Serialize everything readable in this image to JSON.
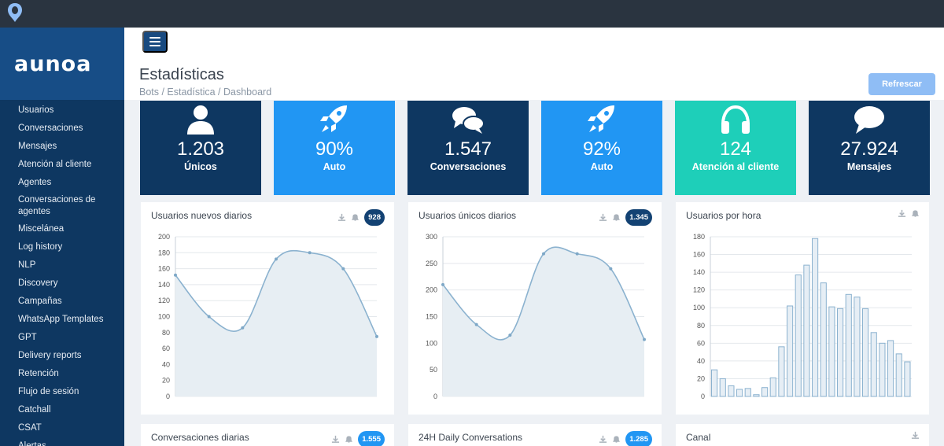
{
  "app": {
    "brand": "aunoa"
  },
  "sidebar": {
    "items": [
      {
        "label": "Usuarios"
      },
      {
        "label": "Conversaciones"
      },
      {
        "label": "Mensajes"
      },
      {
        "label": "Atención al cliente"
      },
      {
        "label": "Agentes"
      },
      {
        "label": "Conversaciones de agentes"
      },
      {
        "label": "Miscelánea"
      },
      {
        "label": "Log history"
      },
      {
        "label": "NLP"
      },
      {
        "label": "Discovery"
      },
      {
        "label": "Campañas"
      },
      {
        "label": "WhatsApp Templates"
      },
      {
        "label": "GPT"
      },
      {
        "label": "Delivery reports"
      },
      {
        "label": "Retención"
      },
      {
        "label": "Flujo de sesión"
      },
      {
        "label": "Catchall"
      },
      {
        "label": "CSAT"
      },
      {
        "label": "Alertas"
      }
    ]
  },
  "header": {
    "title": "Estadísticas",
    "breadcrumb": "Bots / Estadística / Dashboard",
    "refresh_label": "Refrescar"
  },
  "stats": [
    {
      "value": "1.203",
      "label": "Únicos",
      "icon": "user-icon",
      "color": "#0e3761"
    },
    {
      "value": "90%",
      "label": "Auto",
      "icon": "rocket-icon",
      "color": "#2196f3"
    },
    {
      "value": "1.547",
      "label": "Conversaciones",
      "icon": "chat-bubbles-icon",
      "color": "#0e3761"
    },
    {
      "value": "92%",
      "label": "Auto",
      "icon": "rocket-icon",
      "color": "#2196f3"
    },
    {
      "value": "124",
      "label": "Atención al cliente",
      "icon": "headphones-icon",
      "color": "#1ecfb9"
    },
    {
      "value": "27.924",
      "label": "Mensajes",
      "icon": "speech-bubble-icon",
      "color": "#0e3761"
    }
  ],
  "cards": {
    "new_users": {
      "title": "Usuarios nuevos diarios",
      "badge": "928"
    },
    "unique_users": {
      "title": "Usuarios únicos diarios",
      "badge": "1.345"
    },
    "hourly_users": {
      "title": "Usuarios por hora"
    },
    "daily_conv": {
      "title": "Conversaciones diarias",
      "badge": "1.555"
    },
    "daily_conv_24h": {
      "title": "24H Daily Conversations",
      "badge": "1.285"
    },
    "channel": {
      "title": "Canal"
    }
  },
  "chart_data": [
    {
      "type": "area",
      "title": "Usuarios nuevos diarios",
      "ylim": [
        0,
        200
      ],
      "yticks": [
        "0",
        "20",
        "40",
        "60",
        "80",
        "100",
        "120",
        "140",
        "160",
        "180",
        "200"
      ],
      "values": [
        152,
        100,
        86,
        172,
        180,
        160,
        75
      ],
      "grid": true
    },
    {
      "type": "area",
      "title": "Usuarios únicos diarios",
      "ylim": [
        0,
        300
      ],
      "yticks": [
        "0",
        "50",
        "100",
        "150",
        "200",
        "250",
        "300"
      ],
      "values": [
        210,
        135,
        115,
        268,
        268,
        240,
        107
      ],
      "grid": true
    },
    {
      "type": "bar",
      "title": "Usuarios por hora",
      "ylim": [
        0,
        180
      ],
      "yticks": [
        "0",
        "20",
        "40",
        "60",
        "80",
        "100",
        "120",
        "140",
        "160",
        "180"
      ],
      "values": [
        30,
        20,
        12,
        8,
        9,
        2,
        10,
        21,
        56,
        102,
        137,
        148,
        178,
        128,
        101,
        99,
        115,
        112,
        99,
        72,
        60,
        63,
        48,
        39
      ],
      "grid": true
    }
  ]
}
